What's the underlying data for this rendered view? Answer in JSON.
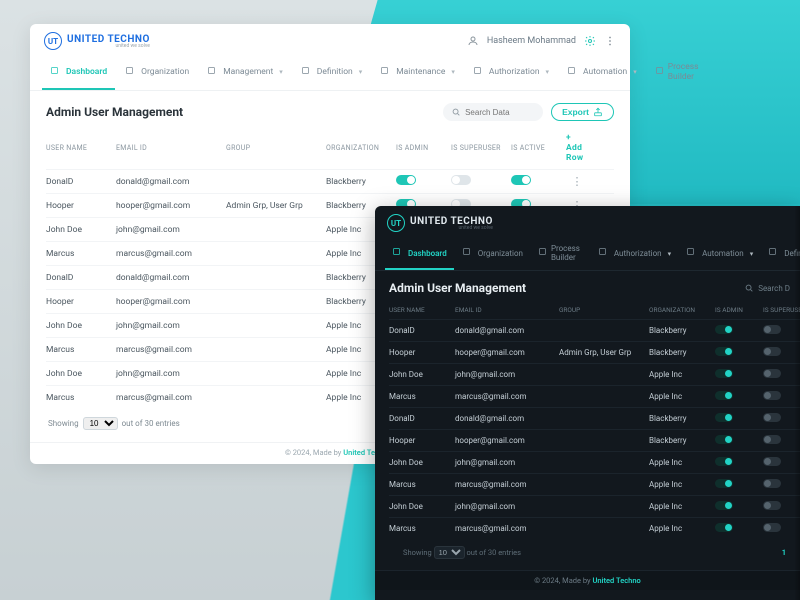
{
  "brand": {
    "abbr": "UT",
    "name": "UNITED TECHNO",
    "tagline": "united we solve"
  },
  "user": {
    "name": "Hasheem Mohammad"
  },
  "tabs_light": [
    {
      "label": "Dashboard",
      "active": true,
      "dropdown": false
    },
    {
      "label": "Organization",
      "active": false,
      "dropdown": false
    },
    {
      "label": "Management",
      "active": false,
      "dropdown": true
    },
    {
      "label": "Definition",
      "active": false,
      "dropdown": true
    },
    {
      "label": "Maintenance",
      "active": false,
      "dropdown": true
    },
    {
      "label": "Authorization",
      "active": false,
      "dropdown": true
    },
    {
      "label": "Automation",
      "active": false,
      "dropdown": true
    },
    {
      "label": "Process Builder",
      "active": false,
      "dropdown": false
    }
  ],
  "tabs_dark": [
    {
      "label": "Dashboard",
      "active": true,
      "dropdown": false
    },
    {
      "label": "Organization",
      "active": false,
      "dropdown": false
    },
    {
      "label": "Process Builder",
      "active": false,
      "dropdown": false
    },
    {
      "label": "Authorization",
      "active": false,
      "dropdown": true
    },
    {
      "label": "Automation",
      "active": false,
      "dropdown": true
    },
    {
      "label": "Definition",
      "active": false,
      "dropdown": true
    }
  ],
  "section": {
    "title": "Admin User Management",
    "search_placeholder": "Search Data",
    "export_label": "Export",
    "add_row_label": "+ Add Row"
  },
  "columns": {
    "user": "USER NAME",
    "email": "EMAIL ID",
    "group": "GROUP",
    "org": "ORGANIZATION",
    "admin": "IS ADMIN",
    "super": "IS SUPERUSER",
    "active": "IS ACTIVE"
  },
  "rows": [
    {
      "user": "DonalD",
      "email": "donald@gmail.com",
      "group": "",
      "org": "Blackberry",
      "admin": true,
      "super": false,
      "active": true
    },
    {
      "user": "Hooper",
      "email": "hooper@gmail.com",
      "group": "Admin Grp, User Grp",
      "org": "Blackberry",
      "admin": true,
      "super": false,
      "active": true
    },
    {
      "user": "John Doe",
      "email": "john@gmail.com",
      "group": "",
      "org": "Apple Inc",
      "admin": true,
      "super": false,
      "active": true
    },
    {
      "user": "Marcus",
      "email": "marcus@gmail.com",
      "group": "",
      "org": "Apple Inc",
      "admin": true,
      "super": false,
      "active": true
    },
    {
      "user": "DonalD",
      "email": "donald@gmail.com",
      "group": "",
      "org": "Blackberry",
      "admin": true,
      "super": false,
      "active": true
    },
    {
      "user": "Hooper",
      "email": "hooper@gmail.com",
      "group": "",
      "org": "Blackberry",
      "admin": true,
      "super": false,
      "active": true
    },
    {
      "user": "John Doe",
      "email": "john@gmail.com",
      "group": "",
      "org": "Apple Inc",
      "admin": true,
      "super": false,
      "active": true
    },
    {
      "user": "Marcus",
      "email": "marcus@gmail.com",
      "group": "",
      "org": "Apple Inc",
      "admin": true,
      "super": false,
      "active": true
    },
    {
      "user": "John Doe",
      "email": "john@gmail.com",
      "group": "",
      "org": "Apple Inc",
      "admin": true,
      "super": false,
      "active": true
    },
    {
      "user": "Marcus",
      "email": "marcus@gmail.com",
      "group": "",
      "org": "Apple Inc",
      "admin": true,
      "super": false,
      "active": true
    }
  ],
  "pager": {
    "showing": "Showing",
    "outof": "out of 30 entries",
    "page_size": "10",
    "current_page": "1"
  },
  "footer": {
    "text": "© 2024, Made by ",
    "brand": "United Techno"
  }
}
